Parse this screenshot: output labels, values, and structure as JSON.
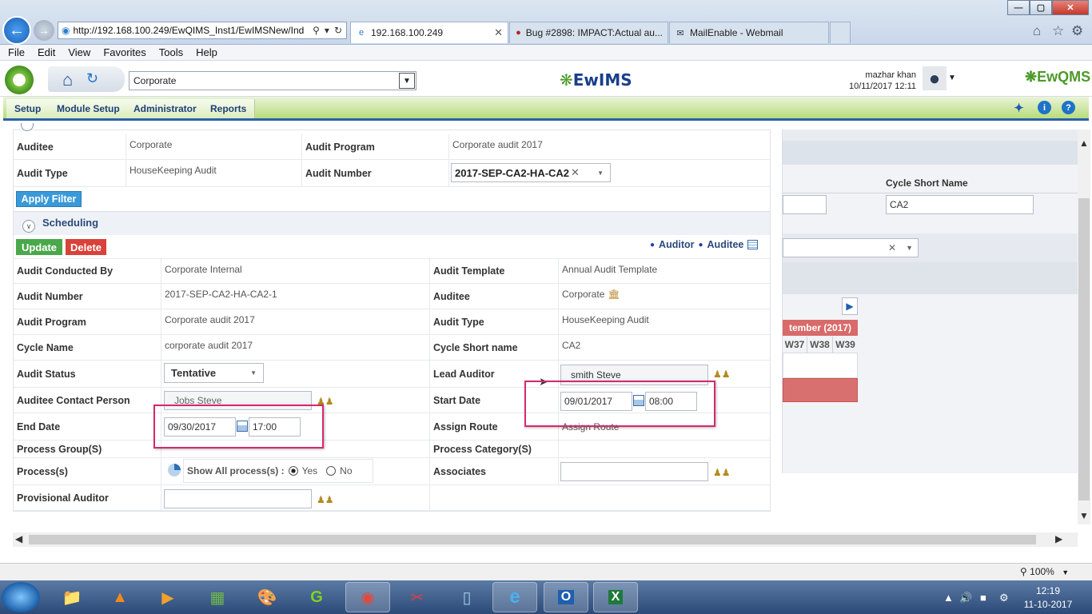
{
  "browser": {
    "address": "http://192.168.100.249/EwQIMS_Inst1/EwIMSNew/Ind",
    "tabs": [
      {
        "label": "192.168.100.249",
        "active": true
      },
      {
        "label": "Bug #2898: IMPACT:Actual au...",
        "active": false
      },
      {
        "label": "MailEnable - Webmail",
        "active": false
      }
    ],
    "menu": [
      "File",
      "Edit",
      "View",
      "Favorites",
      "Tools",
      "Help"
    ]
  },
  "app": {
    "org_select": "Corporate",
    "logo_text": "EwIMS",
    "right_logo": "EwQMS",
    "user_name": "mazhar khan",
    "user_time": "10/11/2017 12:11",
    "nav": [
      "Setup",
      "Module Setup",
      "Administrator",
      "Reports"
    ]
  },
  "filter": {
    "auditee_label": "Auditee",
    "auditee_value": "Corporate",
    "audit_program_label": "Audit Program",
    "audit_program_value": "Corporate audit 2017",
    "audit_type_label": "Audit Type",
    "audit_type_value": "HouseKeeping Audit",
    "audit_number_label": "Audit Number",
    "audit_number_value": "2017-SEP-CA2-HA-CA2",
    "apply_filter": "Apply Filter"
  },
  "scheduling": {
    "title": "Scheduling",
    "update": "Update",
    "delete": "Delete",
    "legend_auditor": "Auditor",
    "legend_auditee": "Auditee",
    "audit_conducted_by_label": "Audit Conducted By",
    "audit_conducted_by_value": "Corporate Internal",
    "audit_template_label": "Audit Template",
    "audit_template_value": "Annual Audit Template",
    "audit_number_label": "Audit Number",
    "audit_number_value": "2017-SEP-CA2-HA-CA2-1",
    "auditee_label": "Auditee",
    "auditee_value": "Corporate",
    "audit_program_label": "Audit Program",
    "audit_program_value": "Corporate audit 2017",
    "audit_type_label": "Audit Type",
    "audit_type_value": "HouseKeeping Audit",
    "cycle_name_label": "Cycle Name",
    "cycle_name_value": "corporate audit 2017",
    "cycle_short_label": "Cycle Short name",
    "cycle_short_value": "CA2",
    "audit_status_label": "Audit Status",
    "audit_status_value": "Tentative",
    "lead_auditor_label": "Lead Auditor",
    "lead_auditor_value": "smith Steve",
    "contact_label": "Auditee Contact Person",
    "contact_value": "Jobs Steve",
    "start_date_label": "Start Date",
    "start_date_value": "09/01/2017",
    "start_time_value": "08:00",
    "end_date_label": "End Date",
    "end_date_value": "09/30/2017",
    "end_time_value": "17:00",
    "assign_route_label": "Assign Route",
    "assign_route_value": "Assign Route",
    "process_group_label": "Process Group(S)",
    "process_category_label": "Process Category(S)",
    "process_label": "Process(s)",
    "show_all_label": "Show All process(s) :",
    "yes_label": "Yes",
    "no_label": "No",
    "associates_label": "Associates",
    "provisional_label": "Provisional Auditor"
  },
  "right_panel": {
    "cycle_short_header": "Cycle Short Name",
    "cycle_short_value": "CA2",
    "month_header": "tember (2017)",
    "weeks": [
      "W37",
      "W38",
      "W39"
    ]
  },
  "status": {
    "zoom": "100%"
  },
  "taskbar": {
    "time": "12:19",
    "date": "11-10-2017"
  },
  "colors": {
    "nav_green": "#b8dc7c",
    "update_green": "#4aa84a",
    "delete_red": "#d9413a",
    "apply_blue": "#3a9ad9",
    "highlight_pink": "#d6286e"
  }
}
